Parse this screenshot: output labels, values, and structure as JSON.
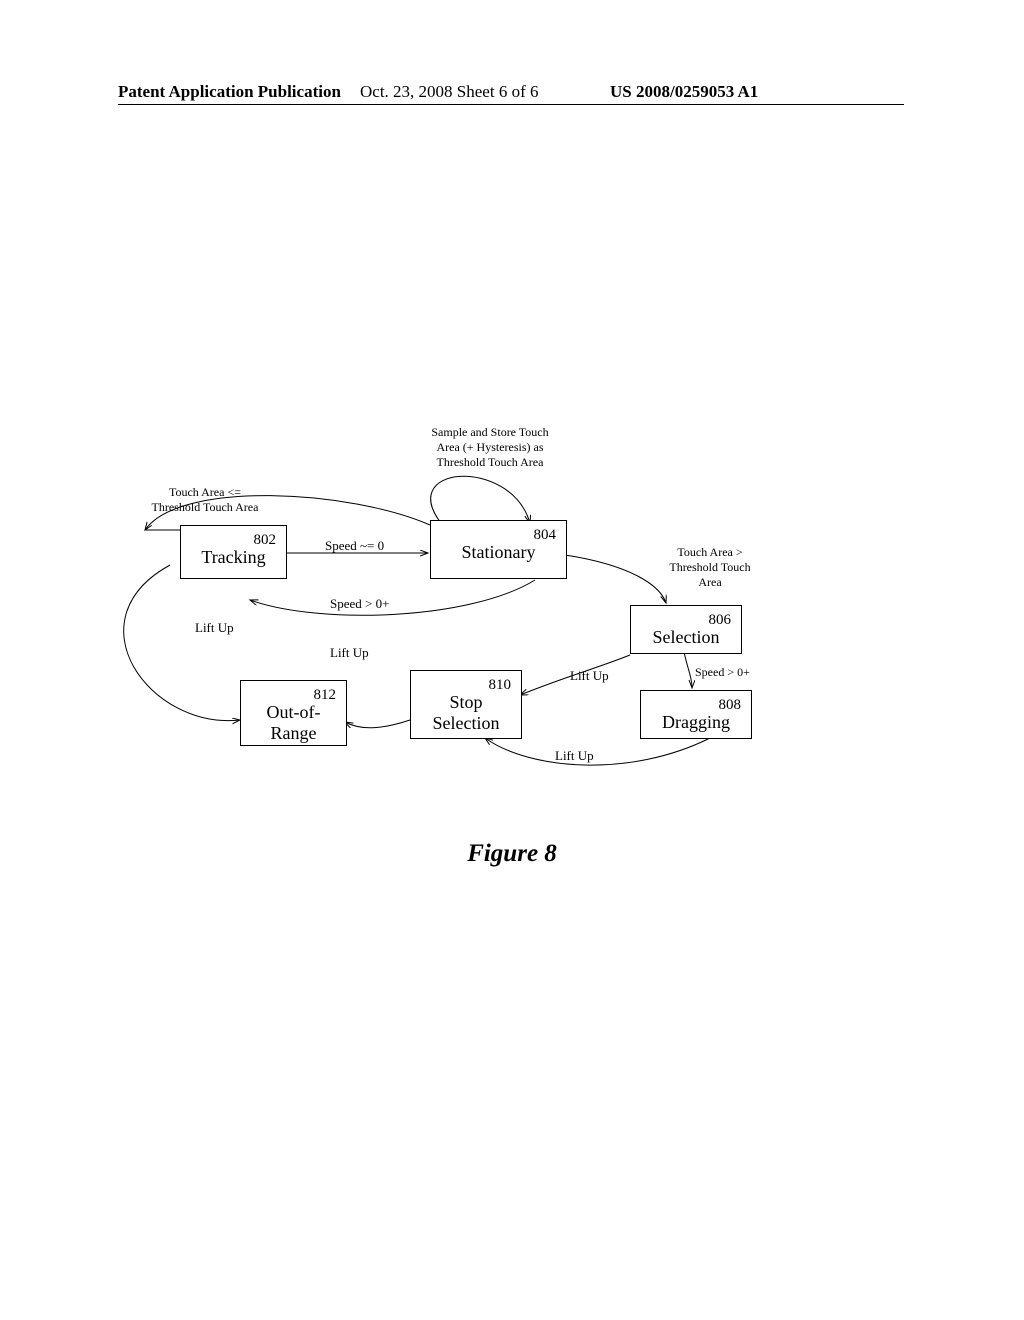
{
  "header": {
    "left": "Patent Application Publication",
    "center": "Oct. 23, 2008   Sheet 6 of 6",
    "right": "US 2008/0259053 A1"
  },
  "caption": "Figure 8",
  "states": {
    "tracking": {
      "num": "802",
      "name": "Tracking"
    },
    "stationary": {
      "num": "804",
      "name": "Stationary"
    },
    "selection": {
      "num": "806",
      "name": "Selection"
    },
    "dragging": {
      "num": "808",
      "name": "Dragging"
    },
    "stop": {
      "num": "810",
      "name": "Stop\nSelection"
    },
    "oor": {
      "num": "812",
      "name": "Out-of-\nRange"
    }
  },
  "labels": {
    "threshold_note": "Sample and Store Touch\nArea (+ Hysteresis) as\nThreshold Touch Area",
    "area_le": "Touch Area <=\nThreshold Touch Area",
    "area_gt": "Touch Area >\nThreshold Touch\nArea",
    "speed0": "Speed ~= 0",
    "speed_pos_1": "Speed > 0+",
    "speed_pos_2": "Speed > 0+",
    "liftup1": "Lift Up",
    "liftup2": "Lift Up",
    "liftup3": "Lift Up",
    "liftup4": "Lift Up"
  }
}
